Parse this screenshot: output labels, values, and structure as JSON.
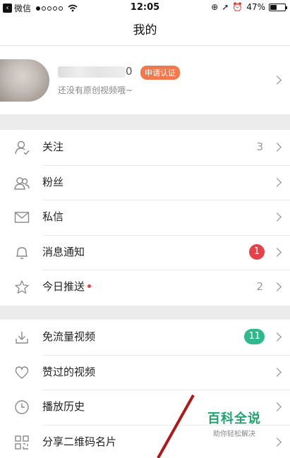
{
  "status_bar": {
    "back_app": "微信",
    "time": "12:05",
    "battery": "47%",
    "battery_level": 0.47
  },
  "nav": {
    "title": "我的"
  },
  "profile": {
    "name_tail": "0",
    "cert_badge": "申请认证",
    "subtitle": "还没有原创视频哦~"
  },
  "menu_group_1": [
    {
      "label": "关注",
      "count": "3",
      "icon": "user-follow-icon"
    },
    {
      "label": "粉丝",
      "icon": "fans-icon"
    },
    {
      "label": "私信",
      "icon": "mail-icon"
    },
    {
      "label": "消息通知",
      "badge": "1",
      "icon": "bell-icon"
    },
    {
      "label": "今日推送",
      "count": "2",
      "icon": "star-icon"
    }
  ],
  "menu_group_2": [
    {
      "label": "免流量视频",
      "badge": "11",
      "icon": "download-icon"
    },
    {
      "label": "赞过的视频",
      "icon": "heart-icon"
    },
    {
      "label": "播放历史",
      "icon": "clock-icon"
    },
    {
      "label": "分享二维码名片",
      "icon": "qrcode-icon"
    }
  ],
  "watermark": {
    "title": "百科全说",
    "subtitle": "助你轻松解决"
  },
  "colors": {
    "cert_badge": "#f5784a",
    "notify_badge": "#e84048",
    "free_badge": "#2fb98d",
    "watermark": "#20a36e"
  }
}
